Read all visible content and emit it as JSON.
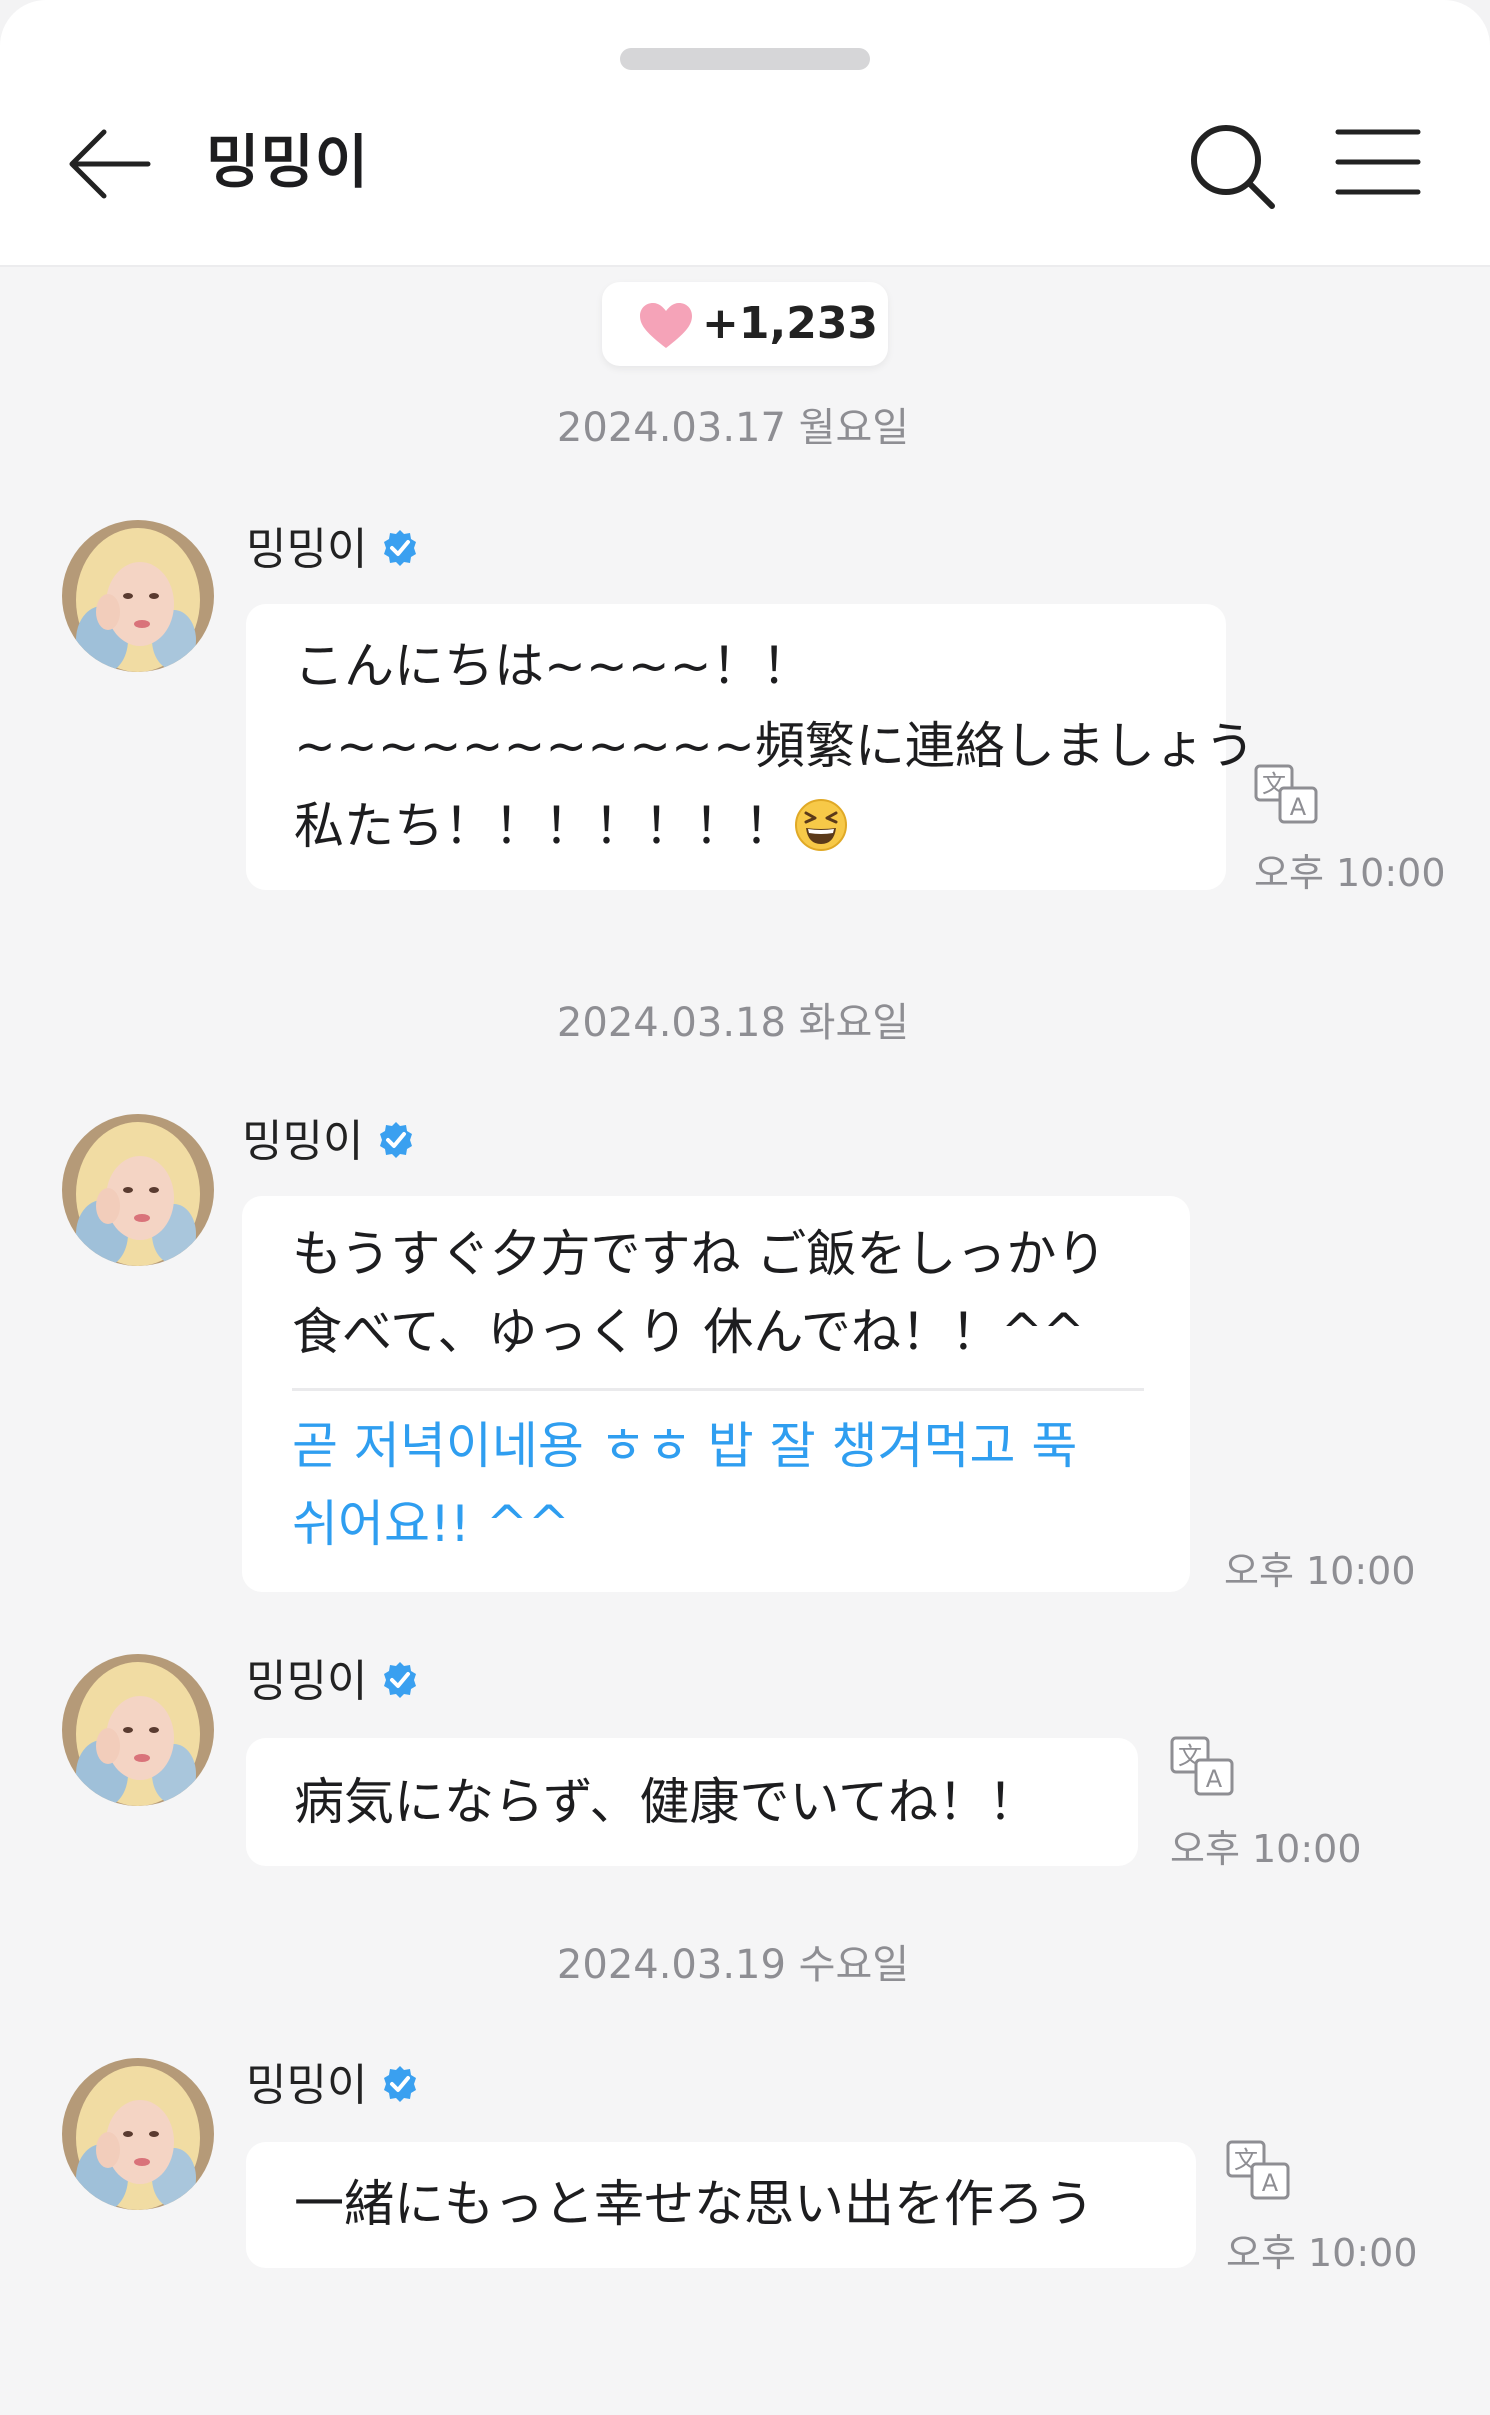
{
  "header": {
    "title": "밍밍이",
    "back_icon": "arrow-left-icon",
    "search_icon": "search-icon",
    "menu_icon": "hamburger-menu-icon"
  },
  "likes": {
    "icon": "heart-icon",
    "count": "+1,233",
    "color": "#f5a3b8"
  },
  "dates": [
    "2024.03.17 월요일",
    "2024.03.18 화요일",
    "2024.03.19 수요일"
  ],
  "messages": [
    {
      "sender": "밍밍이",
      "lines": [
        "こんにちは~~~~！！",
        "~~~~~~~~~~~頻繁に連絡しましょう",
        "私たち！！！！！！！"
      ],
      "emoji": "grinning-squinting-face",
      "time": "오후 10:00",
      "has_translate_icon": true
    },
    {
      "sender": "밍밍이",
      "lines": [
        "もうすぐ夕方ですね ご飯をしっかり",
        "食べて、ゆっくり  休んでね！！^^"
      ],
      "translation": [
        "곧 저녁이네용 ㅎㅎ 밥 잘 챙겨먹고 푹",
        "쉬어요!! ^^"
      ],
      "time": "오후 10:00",
      "has_translate_icon": false
    },
    {
      "sender": "밍밍이",
      "lines": [
        "病気にならず、健康でいてね！！"
      ],
      "time": "오후 10:00",
      "has_translate_icon": true
    },
    {
      "sender": "밍밍이",
      "lines": [
        "一緒にもっと幸せな思い出を作ろう"
      ],
      "time": "오후 10:00",
      "has_translate_icon": true
    }
  ],
  "colors": {
    "accent_blue": "#2f9ef0",
    "verified_blue": "#3aa0f0",
    "background": "#f5f5f6"
  }
}
